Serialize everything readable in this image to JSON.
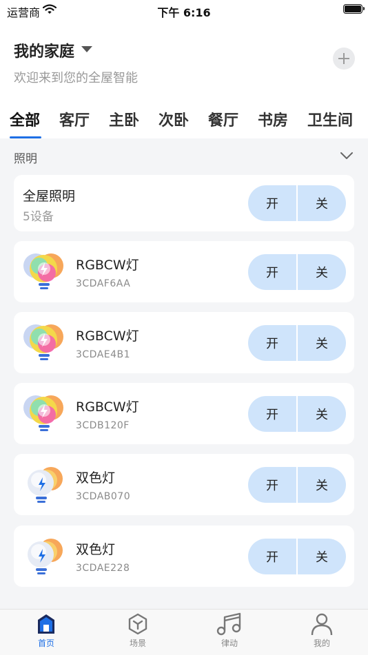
{
  "status_bar": {
    "carrier": "运营商",
    "time": "下午 6:16"
  },
  "header": {
    "home_name": "我的家庭",
    "subtitle": "欢迎来到您的全屋智能"
  },
  "tabs": [
    "全部",
    "客厅",
    "主卧",
    "次卧",
    "餐厅",
    "书房",
    "卫生间"
  ],
  "section": {
    "title": "照明"
  },
  "group": {
    "name": "全屋照明",
    "count": "5设备",
    "on_label": "开",
    "off_label": "关"
  },
  "devices": [
    {
      "name": "RGBCW灯",
      "id": "3CDAF6AA",
      "on_label": "开",
      "off_label": "关",
      "icon": "rgb-bulb-icon"
    },
    {
      "name": "RGBCW灯",
      "id": "3CDAE4B1",
      "on_label": "开",
      "off_label": "关",
      "icon": "rgb-bulb-icon"
    },
    {
      "name": "RGBCW灯",
      "id": "3CDB120F",
      "on_label": "开",
      "off_label": "关",
      "icon": "rgb-bulb-icon"
    },
    {
      "name": "双色灯",
      "id": "3CDAB070",
      "on_label": "开",
      "off_label": "关",
      "icon": "dual-bulb-icon"
    },
    {
      "name": "双色灯",
      "id": "3CDAE228",
      "on_label": "开",
      "off_label": "关",
      "icon": "dual-bulb-icon"
    }
  ],
  "tabbar": {
    "items": [
      {
        "label": "首页",
        "icon": "home-icon",
        "active": true
      },
      {
        "label": "场景",
        "icon": "cube-icon"
      },
      {
        "label": "律动",
        "icon": "music-note-icon"
      },
      {
        "label": "我的",
        "icon": "person-icon"
      }
    ]
  },
  "colors": {
    "accent": "#1e6fe5",
    "button_bg": "#cfe4fb",
    "page_bg": "#f4f5f7"
  }
}
